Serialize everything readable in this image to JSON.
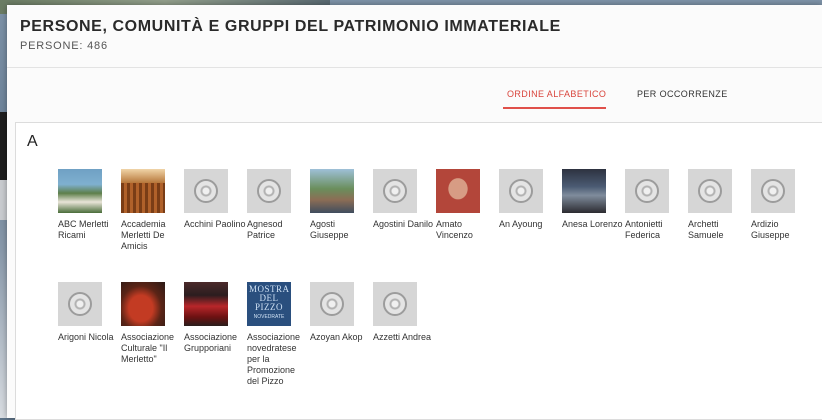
{
  "header": {
    "title": "PERSONE, COMUNITÀ E GRUPPI DEL PATRIMONIO IMMATERIALE",
    "count_label": "PERSONE: 486"
  },
  "tabs": [
    {
      "label": "ORDINE ALFABETICO",
      "active": true
    },
    {
      "label": "PER OCCORRENZE",
      "active": false
    }
  ],
  "section": {
    "letter": "A",
    "items": [
      {
        "name": "ABC Merletti Ricami",
        "thumb": "photo"
      },
      {
        "name": "Accademia Merletti De Amicis",
        "thumb": "photo"
      },
      {
        "name": "Acchini Paolino",
        "thumb": "placeholder-icon"
      },
      {
        "name": "Agnesod Patrice",
        "thumb": "placeholder-icon"
      },
      {
        "name": "Agosti Giuseppe",
        "thumb": "photo"
      },
      {
        "name": "Agostini Danilo",
        "thumb": "placeholder-icon"
      },
      {
        "name": "Amato Vincenzo",
        "thumb": "photo"
      },
      {
        "name": "An Ayoung",
        "thumb": "placeholder-icon"
      },
      {
        "name": "Anesa Lorenzo",
        "thumb": "photo"
      },
      {
        "name": "Antonietti Federica",
        "thumb": "placeholder-icon"
      },
      {
        "name": "Archetti Samuele",
        "thumb": "placeholder-icon"
      },
      {
        "name": "Ardizio Giuseppe",
        "thumb": "placeholder-icon"
      },
      {
        "name": "Arigoni Nicola",
        "thumb": "placeholder-icon"
      },
      {
        "name": "Associazione Culturale \"Il Merletto\"",
        "thumb": "photo"
      },
      {
        "name": "Associazione Grupporiani",
        "thumb": "photo"
      },
      {
        "name": "Associazione novedratese per la Promozione del Pizzo",
        "thumb": "photo",
        "thumb_text": "MOSTRA DEL PIZZO",
        "thumb_subtext": "NOVEDRATE"
      },
      {
        "name": "Azoyan Akop",
        "thumb": "placeholder-icon"
      },
      {
        "name": "Azzetti Andrea",
        "thumb": "placeholder-icon"
      }
    ]
  }
}
